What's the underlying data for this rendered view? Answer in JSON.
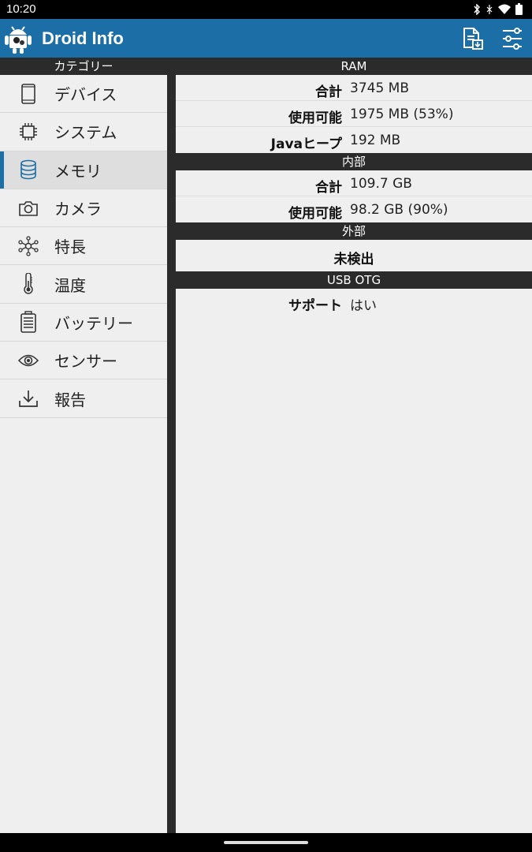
{
  "status_bar": {
    "time": "10:20",
    "icons": [
      "bluetooth-icon",
      "vibrate-icon",
      "wifi-icon",
      "battery-icon"
    ]
  },
  "app_bar": {
    "title": "Droid Info",
    "color": "#1b6fa6",
    "actions": [
      "report-icon",
      "filter-settings-icon"
    ]
  },
  "sidebar": {
    "header": "カテゴリー",
    "active_index": 2,
    "items": [
      {
        "label": "デバイス",
        "icon": "phone-icon"
      },
      {
        "label": "システム",
        "icon": "chip-icon"
      },
      {
        "label": "メモリ",
        "icon": "database-icon"
      },
      {
        "label": "カメラ",
        "icon": "camera-icon"
      },
      {
        "label": "特長",
        "icon": "network-icon"
      },
      {
        "label": "温度",
        "icon": "thermometer-icon"
      },
      {
        "label": "バッテリー",
        "icon": "battery-icon"
      },
      {
        "label": "センサー",
        "icon": "eye-icon"
      },
      {
        "label": "報告",
        "icon": "download-icon"
      }
    ]
  },
  "sections": {
    "ram": {
      "title": "RAM",
      "rows": [
        {
          "key": "合計",
          "value": "3745 MB"
        },
        {
          "key": "使用可能",
          "value": "1975 MB (53%)"
        },
        {
          "key": "Javaヒープ",
          "value": "192 MB"
        }
      ]
    },
    "internal": {
      "title": "内部",
      "rows": [
        {
          "key": "合計",
          "value": "109.7 GB"
        },
        {
          "key": "使用可能",
          "value": "98.2 GB (90%)"
        }
      ]
    },
    "external": {
      "title": "外部",
      "message": "未検出"
    },
    "usb_otg": {
      "title": "USB OTG",
      "rows": [
        {
          "key": "サポート",
          "value": "はい"
        }
      ]
    }
  }
}
